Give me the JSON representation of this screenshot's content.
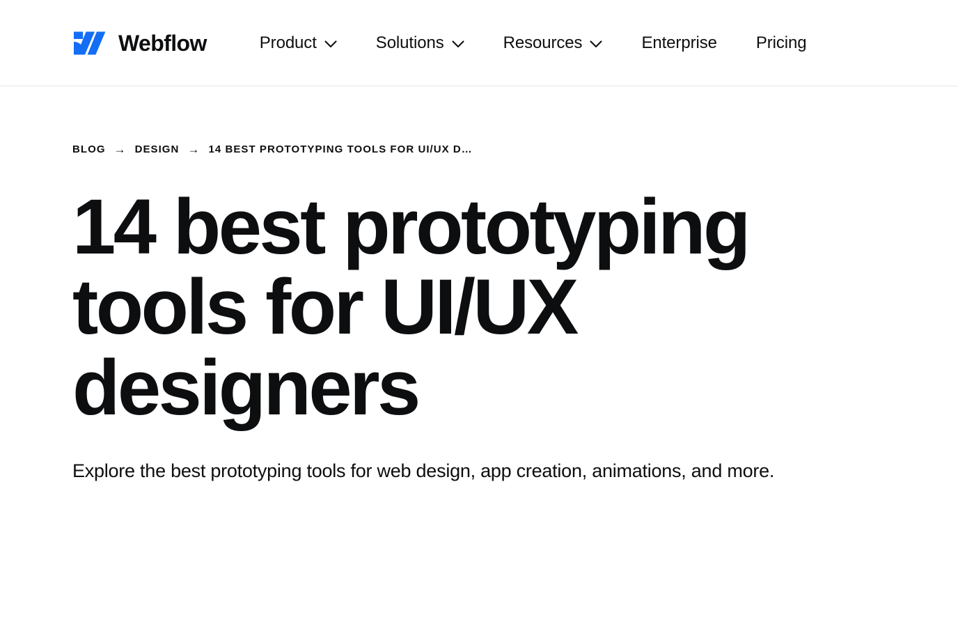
{
  "header": {
    "logo": {
      "icon": "webflow-logo-icon",
      "wordmark": "Webflow",
      "color": "#146EF5"
    },
    "nav": [
      {
        "label": "Product",
        "has_dropdown": true,
        "icon": "chevron-down-icon"
      },
      {
        "label": "Solutions",
        "has_dropdown": true,
        "icon": "chevron-down-icon"
      },
      {
        "label": "Resources",
        "has_dropdown": true,
        "icon": "chevron-down-icon"
      },
      {
        "label": "Enterprise",
        "has_dropdown": false,
        "icon": ""
      },
      {
        "label": "Pricing",
        "has_dropdown": false,
        "icon": ""
      }
    ]
  },
  "article": {
    "breadcrumb": {
      "separator": "→",
      "items": [
        {
          "label": "BLOG"
        },
        {
          "label": "DESIGN"
        },
        {
          "label": "14 BEST PROTOTYPING TOOLS FOR UI/UX D…"
        }
      ]
    },
    "title": "14 best prototyping tools for UI/UX designers",
    "subtitle": "Explore the best prototyping tools for web design, app creation, animations, and more."
  },
  "colors": {
    "brand_blue": "#146EF5",
    "text": "#0D0E10",
    "border": "#E4E6E8",
    "background": "#FFFFFF"
  }
}
